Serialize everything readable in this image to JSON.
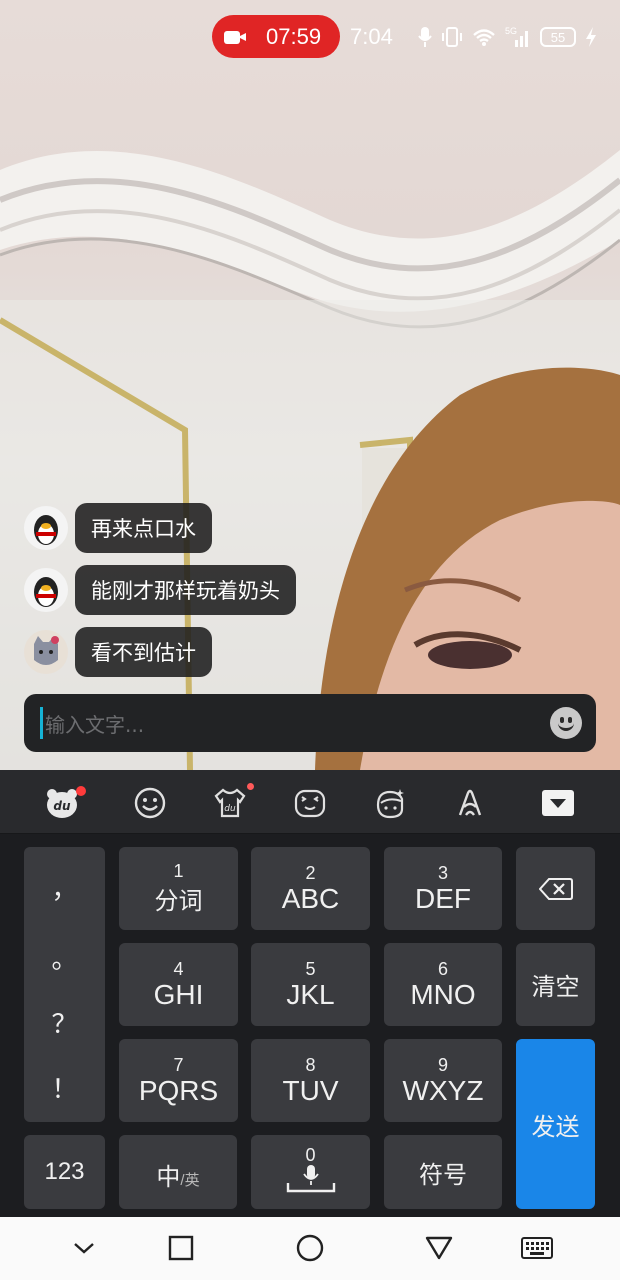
{
  "status_bar": {
    "recording_time": "07:59",
    "clock": "7:04",
    "network": "5G",
    "battery": "55"
  },
  "chat": {
    "messages": [
      {
        "text": "再来点口水"
      },
      {
        "text": "能刚才那样玩着奶头"
      },
      {
        "text": "看不到估计"
      }
    ]
  },
  "input": {
    "placeholder": "输入文字..."
  },
  "keyboard": {
    "toolbar_icons": [
      "du-bear-icon",
      "smiley-icon",
      "skin-shirt-icon",
      "emoticon-face-icon",
      "sticker-face-icon",
      "handwrite-icon",
      "collapse-keyboard-icon"
    ],
    "punctuation": [
      "，",
      "。",
      "？",
      "！"
    ],
    "keys": {
      "k1": {
        "num": "1",
        "label": "分词"
      },
      "k2": {
        "num": "2",
        "label": "ABC"
      },
      "k3": {
        "num": "3",
        "label": "DEF"
      },
      "k4": {
        "num": "4",
        "label": "GHI"
      },
      "k5": {
        "num": "5",
        "label": "JKL"
      },
      "k6": {
        "num": "6",
        "label": "MNO"
      },
      "k7": {
        "num": "7",
        "label": "PQRS"
      },
      "k8": {
        "num": "8",
        "label": "TUV"
      },
      "k9": {
        "num": "9",
        "label": "WXYZ"
      },
      "k0": {
        "num": "0"
      }
    },
    "clear": "清空",
    "send": "发送",
    "num_switch": "123",
    "lang_main": "中",
    "lang_sub": "/英",
    "symbols": "符号",
    "accent_color": "#1a86e8"
  },
  "nav_bar": {
    "icons": [
      "chevron-down-icon",
      "recents-square-icon",
      "home-circle-icon",
      "back-triangle-icon",
      "keyboard-switch-icon"
    ]
  }
}
